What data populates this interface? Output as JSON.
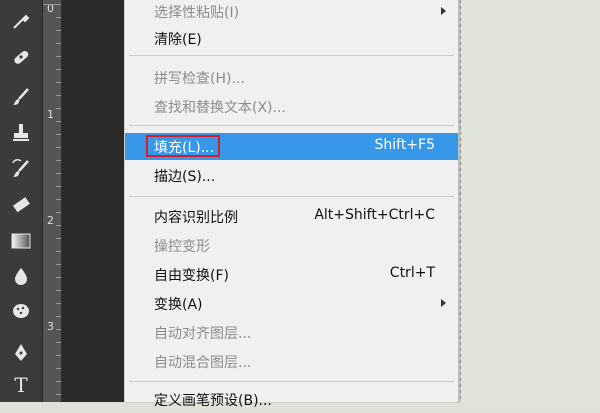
{
  "toolbar": {
    "tools": [
      {
        "icon": "eyedropper-icon"
      },
      {
        "icon": "healing-brush-icon"
      },
      {
        "icon": "brush-icon"
      },
      {
        "icon": "clone-stamp-icon"
      },
      {
        "icon": "history-brush-icon"
      },
      {
        "icon": "eraser-icon"
      },
      {
        "icon": "gradient-icon"
      },
      {
        "icon": "blur-icon"
      },
      {
        "icon": "sponge-icon"
      },
      {
        "icon": "pen-icon"
      },
      {
        "icon": "type-icon",
        "glyph": "T"
      }
    ]
  },
  "ruler": {
    "labels": [
      "0",
      "1",
      "2",
      "3"
    ]
  },
  "menu": {
    "items": [
      {
        "label": "选择性粘贴(I)",
        "submenu": true,
        "disabled": true
      },
      {
        "label": "清除(E)"
      },
      {
        "label": "拼写检查(H)...",
        "disabled": true
      },
      {
        "label": "查找和替换文本(X)...",
        "disabled": true
      },
      {
        "label": "填充(L)...",
        "shortcut": "Shift+F5",
        "highlighted": true
      },
      {
        "label": "描边(S)..."
      },
      {
        "label": "内容识别比例",
        "shortcut": "Alt+Shift+Ctrl+C"
      },
      {
        "label": "操控变形",
        "disabled": true
      },
      {
        "label": "自由变换(F)",
        "shortcut": "Ctrl+T"
      },
      {
        "label": "变换(A)",
        "submenu": true
      },
      {
        "label": "自动对齐图层...",
        "disabled": true
      },
      {
        "label": "自动混合图层...",
        "disabled": true
      },
      {
        "label": "定义画笔预设(B)..."
      }
    ]
  },
  "colors": {
    "highlight": "#3797e8",
    "annotation_box": "#d31f2a",
    "toolbar": "#3b3b3b",
    "menu_background": "#f0f0f0"
  }
}
